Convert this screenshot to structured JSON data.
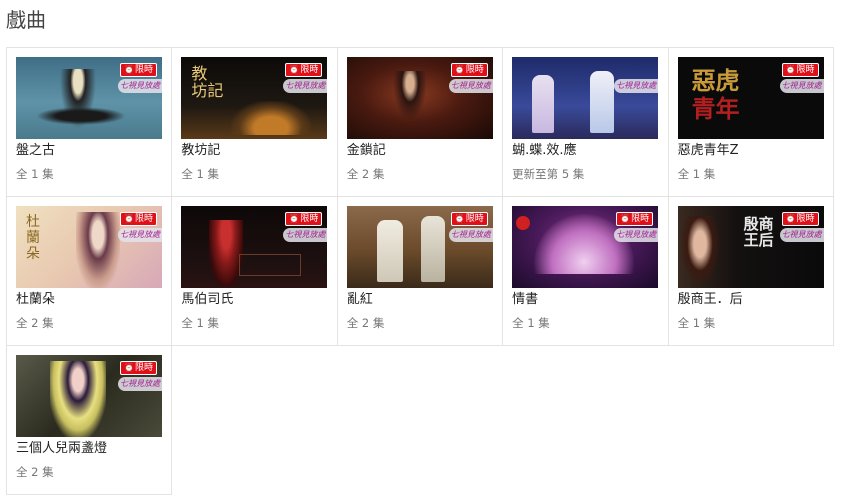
{
  "page": {
    "title": "戲曲"
  },
  "badges": {
    "limit": "限時",
    "brand": "七視見放處"
  },
  "items": [
    {
      "title": "盤之古",
      "episodes": "全 1 集",
      "thumb_bg": "#5a8aa0"
    },
    {
      "title": "教坊記",
      "episodes": "全 1 集",
      "thumb_bg": "#1a1410"
    },
    {
      "title": "金鎖記",
      "episodes": "全 2 集",
      "thumb_bg": "#3a1a10"
    },
    {
      "title": "蝴.蝶.效.應",
      "episodes": "更新至第 5 集",
      "thumb_bg": "#2a2e6a"
    },
    {
      "title": "惡虎青年Z",
      "episodes": "全 1 集",
      "thumb_bg": "#0c0c0c"
    },
    {
      "title": "杜蘭朵",
      "episodes": "全 2 集",
      "thumb_bg": "#e8d2b0"
    },
    {
      "title": "馬伯司氏",
      "episodes": "全 1 集",
      "thumb_bg": "#1a0c0c"
    },
    {
      "title": "亂紅",
      "episodes": "全 2 集",
      "thumb_bg": "#6a4a2a"
    },
    {
      "title": "情書",
      "episodes": "全 1 集",
      "thumb_bg": "#2a0a3a"
    },
    {
      "title": "殷商王．后",
      "episodes": "全 1 集",
      "thumb_bg": "#101010"
    },
    {
      "title": "三個人兒兩盞燈",
      "episodes": "全 2 集",
      "thumb_bg": "#3a3a2a"
    }
  ]
}
